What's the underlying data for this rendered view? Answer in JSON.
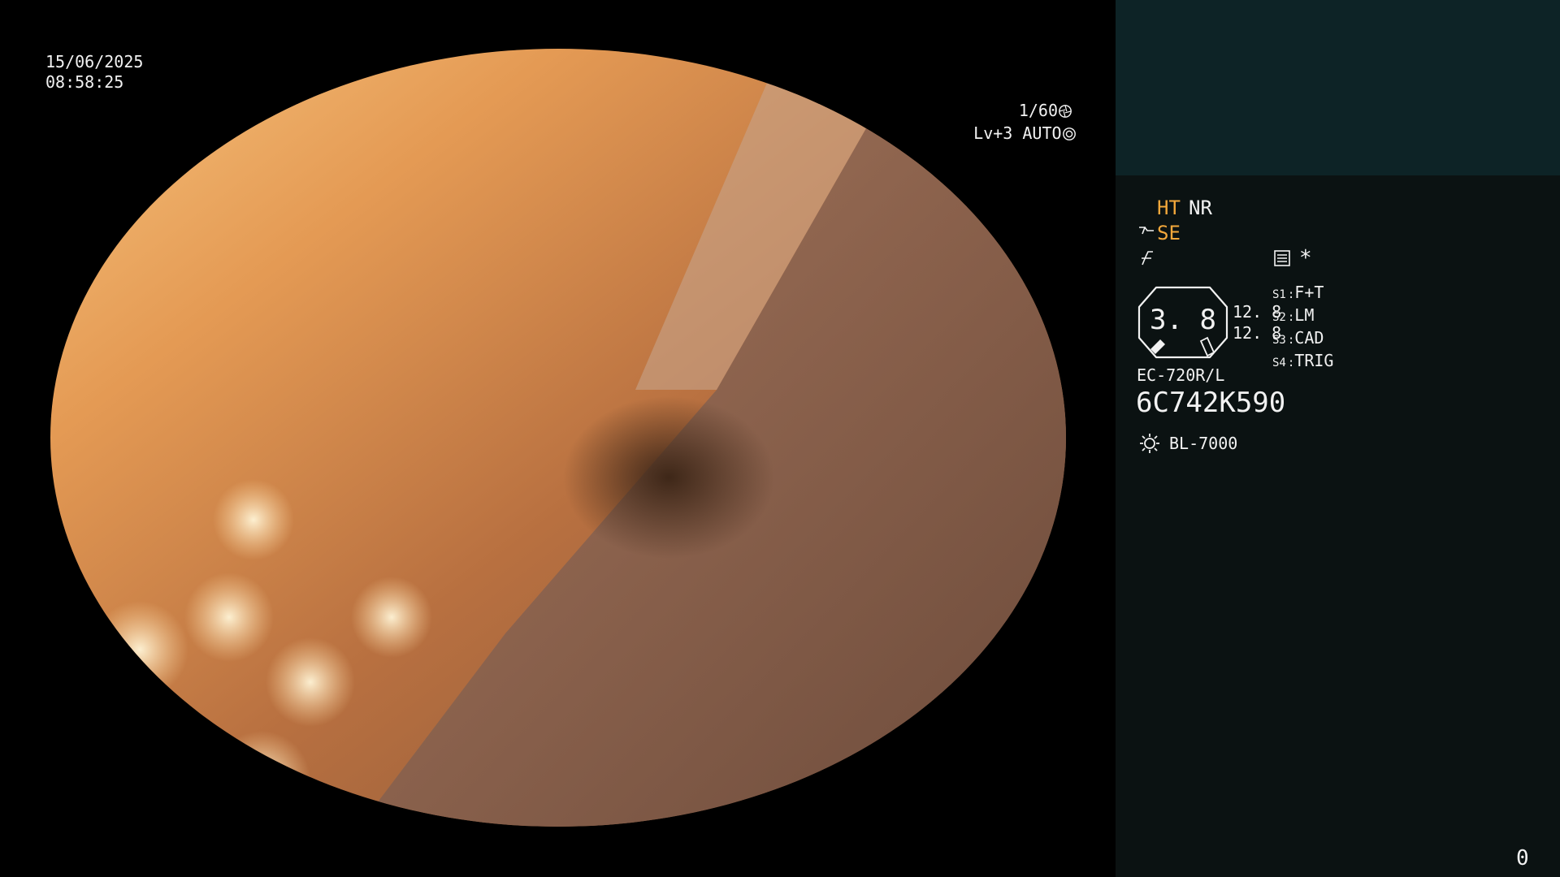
{
  "overlay": {
    "date": "15/06/2025",
    "time": "08:58:25",
    "shutter": "1/60",
    "level": "Lv+3 AUTO"
  },
  "panel": {
    "ht": "HT",
    "nr": "NR",
    "se": "SE",
    "star": "*",
    "gauge_value": "3. 8",
    "value_top": "12. 8",
    "value_bottom": "12. 8",
    "scope_buttons": [
      {
        "key": "S1",
        "value": "F+T"
      },
      {
        "key": "S2",
        "value": "LM"
      },
      {
        "key": "S3",
        "value": "CAD"
      },
      {
        "key": "S4",
        "value": "TRIG"
      }
    ],
    "model": "EC-720R/L",
    "serial": "6C742K590",
    "light_source": "BL-7000",
    "counter": "0",
    "icons": {
      "se": "se-icon",
      "f": "f-icon",
      "memo": "memo-icon",
      "bulb": "bulb-icon",
      "shutter": "shutter-icon",
      "iris": "iris-icon"
    },
    "colors": {
      "accent": "#f3a83b",
      "panel_bg": "#0b1212",
      "thumb_bg": "#0d2326"
    }
  }
}
